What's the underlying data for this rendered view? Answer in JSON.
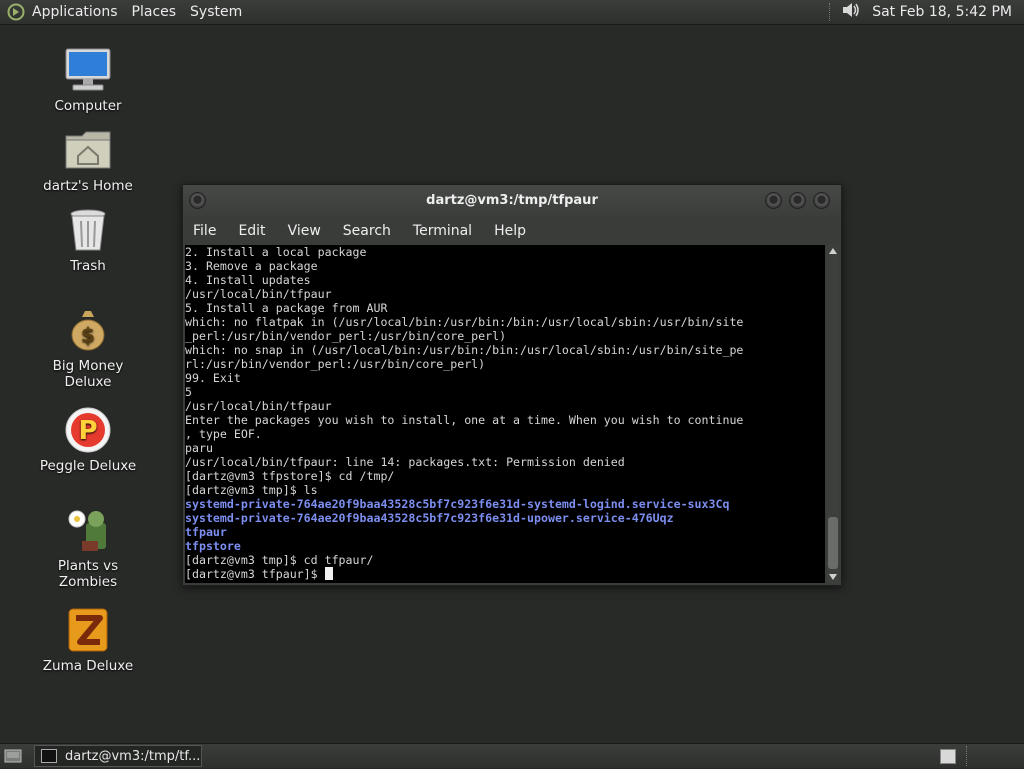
{
  "top_panel": {
    "menus": [
      "Applications",
      "Places",
      "System"
    ],
    "clock": "Sat Feb 18,  5:42 PM"
  },
  "desktop": {
    "icons": [
      {
        "label": "Computer",
        "icon": "computer-icon"
      },
      {
        "label": "dartz's Home",
        "icon": "home-folder-icon"
      },
      {
        "label": "Trash",
        "icon": "trash-icon"
      },
      {
        "label": "Big Money Deluxe",
        "icon": "money-bag-icon"
      },
      {
        "label": "Peggle Deluxe",
        "icon": "peggle-icon"
      },
      {
        "label": "Plants vs Zombies",
        "icon": "plants-zombies-icon"
      },
      {
        "label": "Zuma Deluxe",
        "icon": "zuma-icon"
      }
    ]
  },
  "window": {
    "title": "dartz@vm3:/tmp/tfpaur",
    "menu": [
      "File",
      "Edit",
      "View",
      "Search",
      "Terminal",
      "Help"
    ],
    "terminal_lines": [
      {
        "text": "2. Install a local package",
        "style": "normal"
      },
      {
        "text": "3. Remove a package",
        "style": "normal"
      },
      {
        "text": "4. Install updates",
        "style": "normal"
      },
      {
        "text": "/usr/local/bin/tfpaur",
        "style": "normal"
      },
      {
        "text": "5. Install a package from AUR",
        "style": "normal"
      },
      {
        "text": "which: no flatpak in (/usr/local/bin:/usr/bin:/bin:/usr/local/sbin:/usr/bin/site",
        "style": "normal"
      },
      {
        "text": "_perl:/usr/bin/vendor_perl:/usr/bin/core_perl)",
        "style": "normal"
      },
      {
        "text": "which: no snap in (/usr/local/bin:/usr/bin:/bin:/usr/local/sbin:/usr/bin/site_pe",
        "style": "normal"
      },
      {
        "text": "rl:/usr/bin/vendor_perl:/usr/bin/core_perl)",
        "style": "normal"
      },
      {
        "text": "99. Exit",
        "style": "normal"
      },
      {
        "text": "5",
        "style": "normal"
      },
      {
        "text": "/usr/local/bin/tfpaur",
        "style": "normal"
      },
      {
        "text": "Enter the packages you wish to install, one at a time. When you wish to continue",
        "style": "normal"
      },
      {
        "text": ", type EOF.",
        "style": "normal"
      },
      {
        "text": "paru",
        "style": "normal"
      },
      {
        "text": "/usr/local/bin/tfpaur: line 14: packages.txt: Permission denied",
        "style": "normal"
      },
      {
        "text": "[dartz@vm3 tfpstore]$ cd /tmp/",
        "style": "normal"
      },
      {
        "text": "[dartz@vm3 tmp]$ ls",
        "style": "normal"
      },
      {
        "text": "systemd-private-764ae20f9baa43528c5bf7c923f6e31d-systemd-logind.service-sux3Cq",
        "style": "dir"
      },
      {
        "text": "systemd-private-764ae20f9baa43528c5bf7c923f6e31d-upower.service-476Uqz",
        "style": "dir"
      },
      {
        "text": "tfpaur",
        "style": "dir"
      },
      {
        "text": "tfpstore",
        "style": "dir"
      },
      {
        "text": "[dartz@vm3 tmp]$ cd tfpaur/",
        "style": "normal"
      },
      {
        "text": "[dartz@vm3 tfpaur]$ ",
        "style": "prompt"
      }
    ]
  },
  "bottom_panel": {
    "task_label": "dartz@vm3:/tmp/tf..."
  }
}
